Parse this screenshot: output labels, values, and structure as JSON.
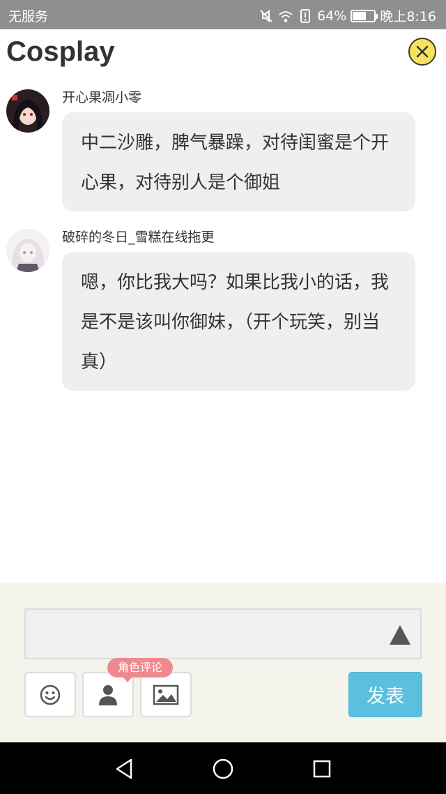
{
  "status_bar": {
    "carrier": "无服务",
    "battery": "64%",
    "battery_level": 0.64,
    "time": "晚上8:16",
    "icons": [
      "mute-icon",
      "wifi-icon",
      "alert-icon",
      "battery-icon"
    ]
  },
  "header": {
    "title": "Cosplay",
    "close_icon": "close-icon",
    "close_color": "#f7e25b"
  },
  "comments": [
    {
      "author": "开心果凋小零",
      "text": "中二沙雕，脾气暴躁，对待闺蜜是个开心果，对待别人是个御姐"
    },
    {
      "author": "破碎的冬日_雪糕在线拖更",
      "text": "嗯，你比我大吗？如果比我小的话，我是不是该叫你御妹，（开个玩笑，别当真）"
    }
  ],
  "composer": {
    "input_value": "",
    "expand_icon": "triangle-up-icon",
    "tools": [
      "emoji-icon",
      "person-icon",
      "image-icon"
    ],
    "role_tooltip": "角色评论",
    "send_label": "发表",
    "send_color": "#5bc0de"
  },
  "nav": {
    "icons": [
      "back-icon",
      "home-icon",
      "recents-icon"
    ]
  }
}
